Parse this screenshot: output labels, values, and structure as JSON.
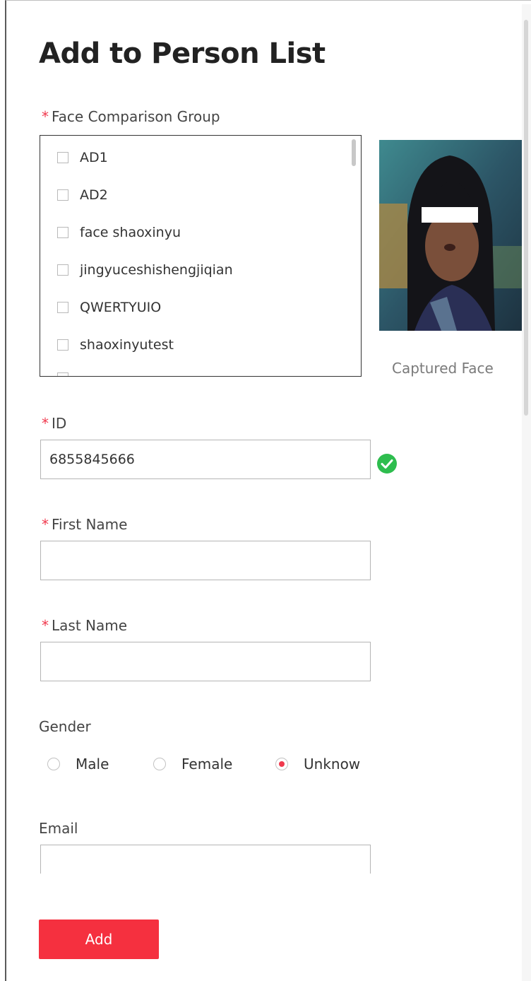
{
  "dialog": {
    "title": "Add to Person List"
  },
  "group": {
    "required_mark": "*",
    "label": "Face Comparison Group",
    "items": [
      {
        "label": "AD1",
        "checked": false
      },
      {
        "label": "AD2",
        "checked": false
      },
      {
        "label": "face shaoxinyu",
        "checked": false
      },
      {
        "label": "jingyuceshishengjiqian",
        "checked": false
      },
      {
        "label": "QWERTYUIO",
        "checked": false
      },
      {
        "label": "shaoxinyutest",
        "checked": false
      }
    ]
  },
  "captured": {
    "caption": "Captured Face"
  },
  "id_field": {
    "required_mark": "*",
    "label": "ID",
    "value": "6855845666",
    "status_icon": "check-circle-icon"
  },
  "first_name": {
    "required_mark": "*",
    "label": "First Name",
    "value": ""
  },
  "last_name": {
    "required_mark": "*",
    "label": "Last Name",
    "value": ""
  },
  "gender": {
    "label": "Gender",
    "options": [
      {
        "label": "Male",
        "selected": false
      },
      {
        "label": "Female",
        "selected": false
      },
      {
        "label": "Unknow",
        "selected": true
      }
    ]
  },
  "email": {
    "label": "Email",
    "value": ""
  },
  "actions": {
    "add_label": "Add"
  },
  "colors": {
    "accent": "#f5303f",
    "success": "#2ebd4e"
  }
}
